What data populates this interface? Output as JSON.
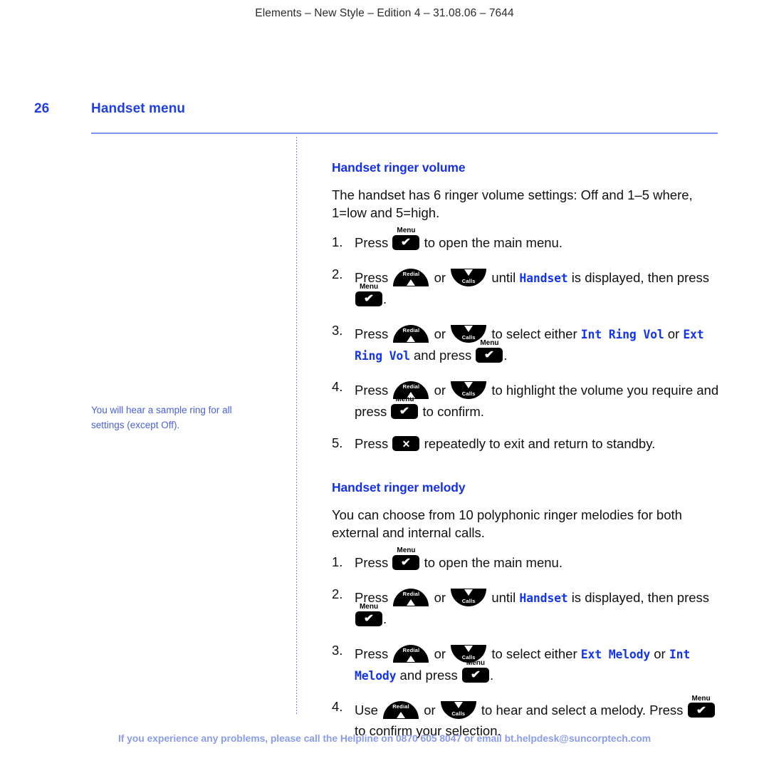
{
  "running_header": "Elements – New Style – Edition 4 – 31.08.06 – 7644",
  "page": {
    "folio": "26",
    "title": "Handset menu"
  },
  "sidenote": {
    "text": "You will hear a sample ring for all settings (except Off)."
  },
  "keys": {
    "menu_caption": "Menu",
    "menu_glyph": "✔",
    "redial_label": "Redial",
    "calls_label": "Calls",
    "cancel_glyph": "✕"
  },
  "sections": [
    {
      "heading": "Handset ringer volume",
      "intro": "The handset has 6 ringer volume settings: Off and 1–5 where, 1=low and 5=high.",
      "steps": {
        "s1": {
          "num": "1.",
          "a": "Press",
          "b": "to open the main menu."
        },
        "s2": {
          "num": "2.",
          "a": "Press",
          "b": "or",
          "c": "until",
          "lcd": "Handset",
          "d": "is displayed, then press",
          "e": "."
        },
        "s3": {
          "num": "3.",
          "a": "Press",
          "b": "or",
          "c": "to select either",
          "lcd1": "Int Ring Vol",
          "d": "or",
          "lcd2": "Ext Ring Vol",
          "e": "and press",
          "f": "."
        },
        "s4": {
          "num": "4.",
          "a": "Press",
          "b": "or",
          "c": "to highlight the volume you require and press",
          "d": "to confirm."
        },
        "s5": {
          "num": "5.",
          "a": "Press",
          "b": "repeatedly to exit and return to standby."
        }
      }
    },
    {
      "heading": "Handset ringer melody",
      "intro": "You can choose from 10 polyphonic ringer melodies for both external and internal calls.",
      "steps": {
        "s1": {
          "num": "1.",
          "a": "Press",
          "b": "to open the main menu."
        },
        "s2": {
          "num": "2.",
          "a": "Press",
          "b": "or",
          "c": "until",
          "lcd": "Handset",
          "d": "is displayed, then press",
          "e": "."
        },
        "s3": {
          "num": "3.",
          "a": "Press",
          "b": "or",
          "c": "to select either",
          "lcd1": "Ext Melody",
          "d": "or",
          "lcd2": "Int Melody",
          "e": "and press",
          "f": "."
        },
        "s4": {
          "num": "4.",
          "a": "Use",
          "b": "or",
          "c": "to hear and select a melody. Press",
          "d": "to confirm your selection."
        }
      }
    }
  ],
  "footer": {
    "text": "If you experience any problems, please call the Helpline on 0870 605 8047 or email bt.helpdesk@suncorptech.com"
  },
  "colors": {
    "heading_blue": "#1530e8",
    "rule_blue": "#7d8fe8",
    "sidenote_blue": "#4a5fe0",
    "footer_blue": "#8b9ced",
    "lcd_blue": "#1535ec"
  }
}
